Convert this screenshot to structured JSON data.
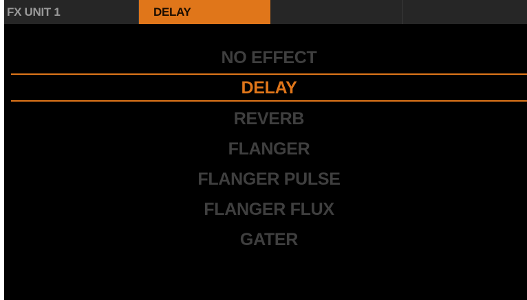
{
  "tabs": [
    {
      "label": "FX UNIT 1"
    },
    {
      "label": "DELAY",
      "active": true
    },
    {
      "label": ""
    },
    {
      "label": ""
    }
  ],
  "effects": {
    "items": [
      {
        "label": "NO EFFECT"
      },
      {
        "label": "DELAY",
        "selected": true
      },
      {
        "label": "REVERB"
      },
      {
        "label": "FLANGER"
      },
      {
        "label": "FLANGER PULSE"
      },
      {
        "label": "FLANGER FLUX"
      },
      {
        "label": "GATER"
      }
    ]
  },
  "colors": {
    "accent": "#e0761a",
    "background": "#000000",
    "tab_background": "#262626",
    "inactive_text": "#3f3f3f"
  }
}
